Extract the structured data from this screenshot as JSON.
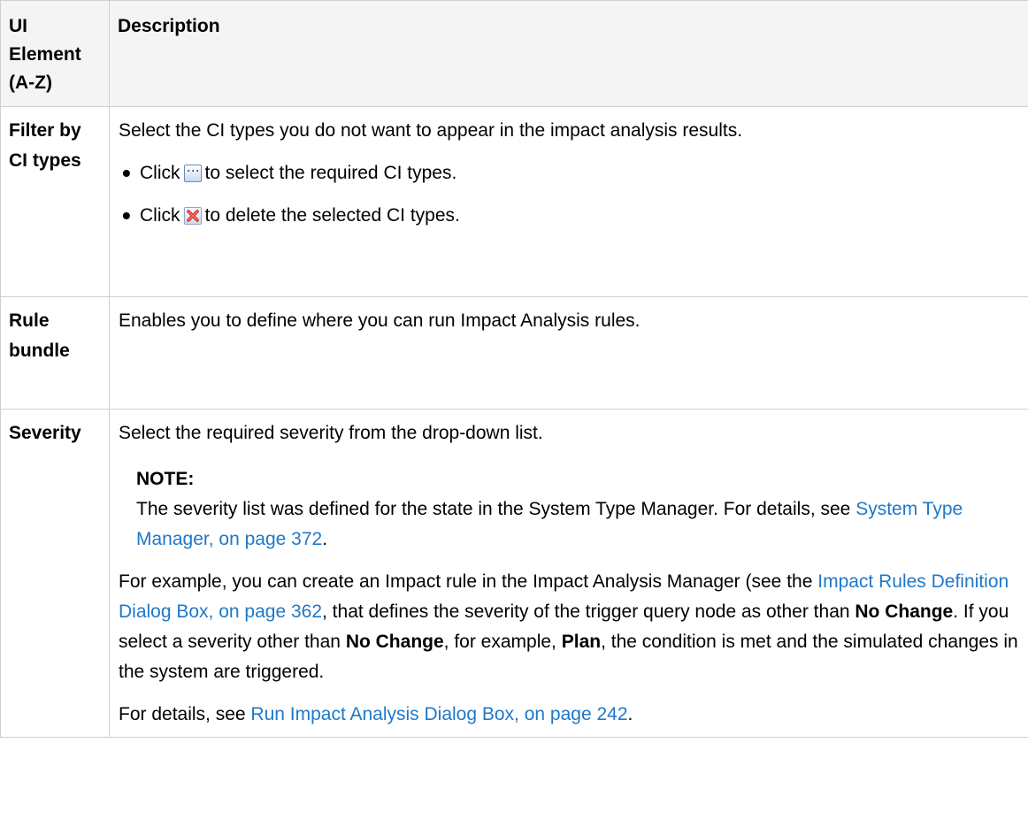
{
  "header": {
    "col_element": "UI Element (A-Z)",
    "col_description": "Description"
  },
  "rows": {
    "filter": {
      "element": "Filter by CI types",
      "intro": "Select the CI types you do not want to appear in the impact analysis results.",
      "bullet1_pre": "Click",
      "bullet1_post": "to select the required CI types.",
      "bullet2_pre": "Click",
      "bullet2_post": "to delete the selected CI types."
    },
    "rule": {
      "element": "Rule bundle",
      "description": "Enables you to define where you can run Impact Analysis rules."
    },
    "severity": {
      "element": "Severity",
      "intro": "Select the required severity from the drop-down list.",
      "note_title": "NOTE:",
      "note_text": "The severity list was defined for the state in the System Type Manager. For details, see",
      "note_link": "System Type Manager, on page 372",
      "note_end": ".",
      "example_1": "For example, you can create an Impact rule in the Impact Analysis Manager (see the",
      "example_link": "Impact Rules Definition Dialog Box, on page 362",
      "example_2": ", that defines the severity of the trigger query node as other than",
      "bold_no_change": "No Change",
      "example_3": ". If you select a severity other than",
      "bold_no_change_2": "No Change",
      "example_4": ", for example,",
      "bold_plan": "Plan",
      "example_5": ", the condition is met and the simulated changes in the system are triggered.",
      "details_pre": "For details, see",
      "details_link": "Run Impact Analysis Dialog Box, on page 242",
      "details_end": "."
    }
  },
  "icons": {
    "select_button": "ellipsis-button-icon",
    "delete_button": "delete-x-icon"
  },
  "colors": {
    "link": "#1f78c8",
    "header_bg": "#f4f4f4",
    "border": "#cfcfcf"
  }
}
